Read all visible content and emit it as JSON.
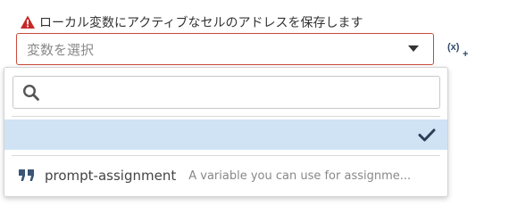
{
  "field": {
    "label": "ローカル変数にアクティブなセルのアドレスを保存します",
    "warning_icon": "warning-triangle-icon",
    "warning_color": "#c62828"
  },
  "select": {
    "placeholder": "変数を選択",
    "border_color": "#c94a3c",
    "caret_icon": "caret-down-icon"
  },
  "insert_variable": {
    "icon": "insert-variable-icon",
    "text": "(x)",
    "plus": "+"
  },
  "dropdown": {
    "search": {
      "placeholder": "",
      "value": "",
      "icon": "search-icon"
    },
    "options": [
      {
        "name": "",
        "description": "",
        "selected": true,
        "icon": "check-icon",
        "highlight_color": "#cfe3f5"
      },
      {
        "name": "prompt-assignment",
        "description": "A variable you can use for assignme...",
        "selected": false,
        "icon": "quote-icon"
      }
    ]
  }
}
